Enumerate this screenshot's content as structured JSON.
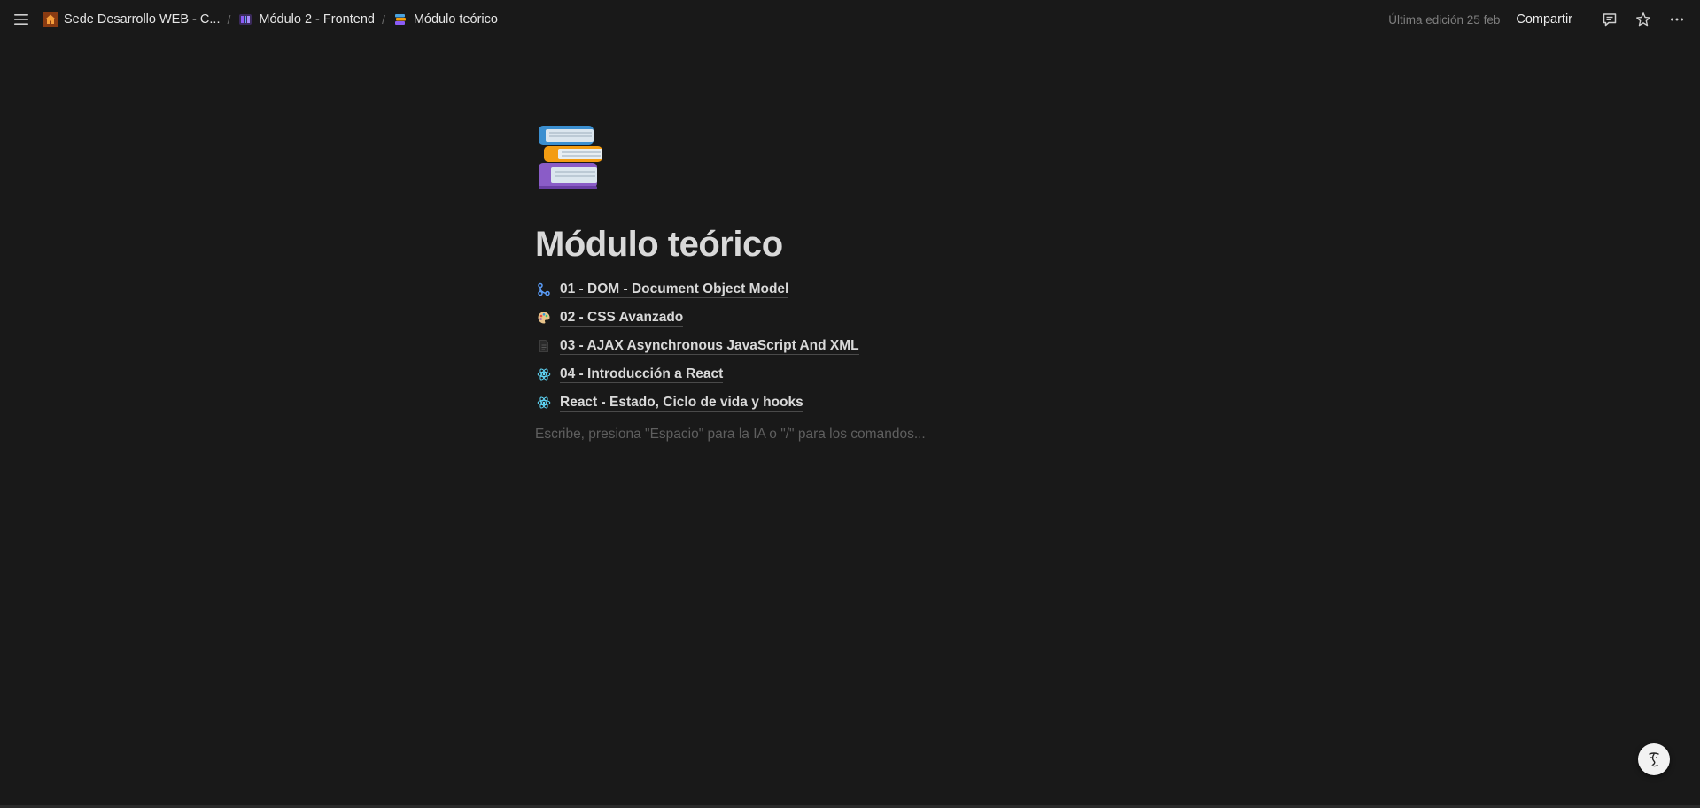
{
  "breadcrumbs": [
    {
      "label": "Sede Desarrollo WEB - C...",
      "icon": "house-icon"
    },
    {
      "label": "Módulo 2 - Frontend",
      "icon": "module-icon"
    },
    {
      "label": "Módulo teórico",
      "icon": "books-icon"
    }
  ],
  "separator": "/",
  "topbar": {
    "last_edited": "Última edición 25 feb",
    "share_label": "Compartir"
  },
  "page": {
    "icon": "books-emoji",
    "title": "Módulo teórico",
    "links": [
      {
        "label": "01 - DOM - Document Object Model",
        "icon": "git-branch-icon"
      },
      {
        "label": "02 - CSS Avanzado",
        "icon": "palette-icon"
      },
      {
        "label": "03 - AJAX Asynchronous JavaScript And XML",
        "icon": "document-icon"
      },
      {
        "label": "04 - Introducción a React",
        "icon": "react-icon"
      },
      {
        "label": "React - Estado, Ciclo de vida y hooks",
        "icon": "react-icon"
      }
    ],
    "placeholder": "Escribe, presiona \"Espacio\" para la IA o \"/\" para los comandos..."
  },
  "colors": {
    "background": "#191919",
    "text": "#d9d9d9",
    "muted": "#7f7f7f",
    "react": "#61dafb"
  }
}
